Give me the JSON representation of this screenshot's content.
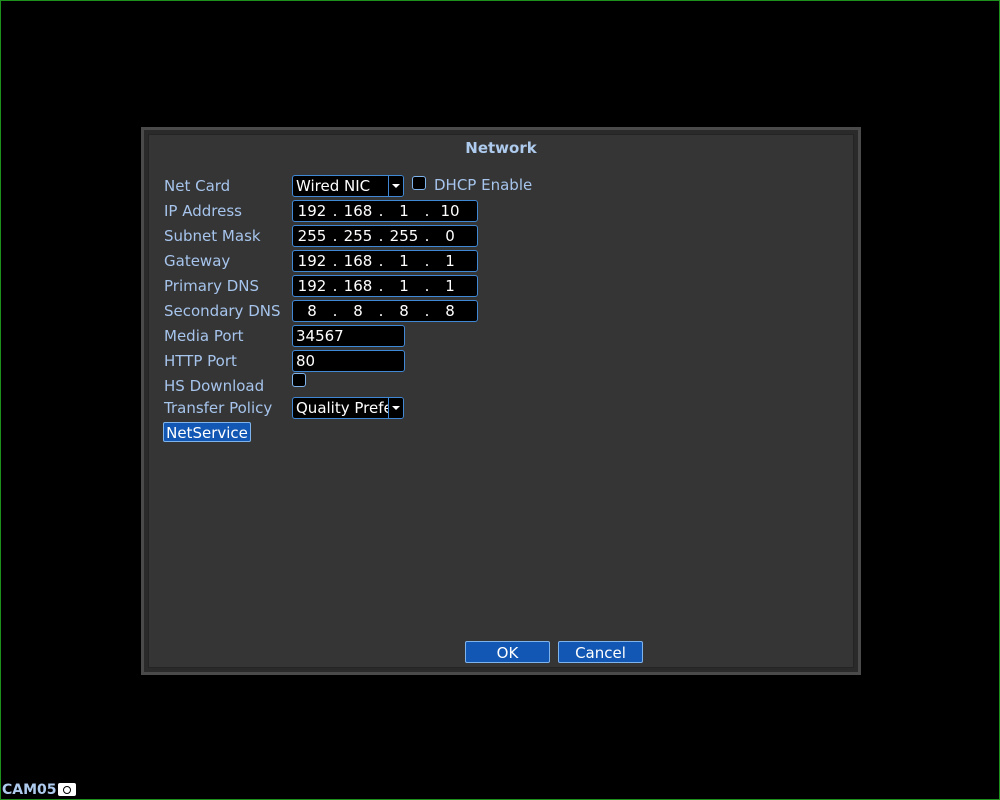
{
  "dialog": {
    "title": "Network"
  },
  "fields": {
    "net_card": {
      "label": "Net Card",
      "value": "Wired NIC"
    },
    "dhcp": {
      "label": "DHCP Enable",
      "checked": false
    },
    "ip_address": {
      "label": "IP Address",
      "octets": [
        "192",
        "168",
        "1",
        "10"
      ]
    },
    "subnet_mask": {
      "label": "Subnet Mask",
      "octets": [
        "255",
        "255",
        "255",
        "0"
      ]
    },
    "gateway": {
      "label": "Gateway",
      "octets": [
        "192",
        "168",
        "1",
        "1"
      ]
    },
    "primary_dns": {
      "label": "Primary DNS",
      "octets": [
        "192",
        "168",
        "1",
        "1"
      ]
    },
    "secondary_dns": {
      "label": "Secondary DNS",
      "octets": [
        "8",
        "8",
        "8",
        "8"
      ]
    },
    "media_port": {
      "label": "Media Port",
      "value": "34567"
    },
    "http_port": {
      "label": "HTTP Port",
      "value": "80"
    },
    "hs_download": {
      "label": "HS Download",
      "checked": false
    },
    "transfer_policy": {
      "label": "Transfer Policy",
      "value": "Quality Prefe"
    }
  },
  "buttons": {
    "netservice": "NetService",
    "ok": "OK",
    "cancel": "Cancel"
  },
  "status": {
    "camera": "CAM05",
    "camera_icon": "camera-icon"
  },
  "colors": {
    "label": "#a6c4ec",
    "field_border": "#3f88d6",
    "button_bg": "#1157b3",
    "frame": "#1c8f1c"
  }
}
